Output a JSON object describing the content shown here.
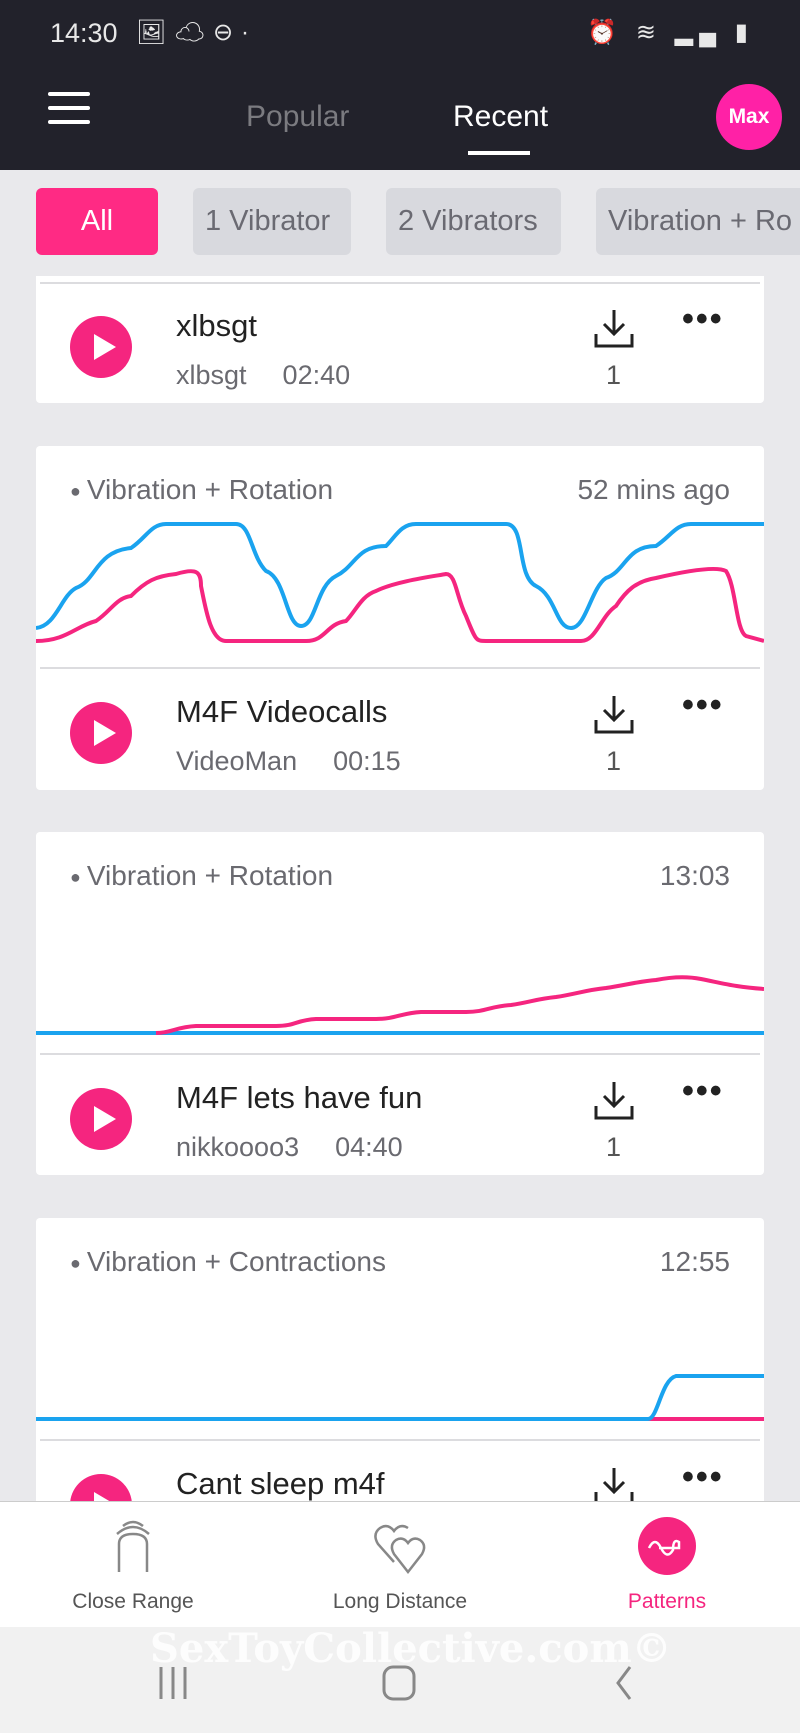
{
  "status_bar": {
    "time": "14:30",
    "left_icons": [
      "image-icon",
      "cloud-sync-icon",
      "dnd-icon",
      "dot-icon"
    ],
    "right_icons": [
      "alarm-icon",
      "wifi-icon",
      "signal-icon",
      "battery-icon"
    ]
  },
  "header": {
    "tabs": [
      {
        "label": "Popular",
        "active": false
      },
      {
        "label": "Recent",
        "active": true
      }
    ],
    "avatar": "Max"
  },
  "filters": [
    {
      "label": "All",
      "active": true
    },
    {
      "label": "1 Vibrator"
    },
    {
      "label": "2 Vibrators"
    },
    {
      "label": "Vibration + Ro"
    }
  ],
  "patterns": [
    {
      "title": "xlbsgt",
      "author": "xlbsgt",
      "duration": "02:40",
      "downloads": "1"
    },
    {
      "type": "Vibration + Rotation",
      "when": "52 mins ago",
      "title": "M4F Videocalls",
      "author": "VideoMan",
      "duration": "00:15",
      "downloads": "1"
    },
    {
      "type": "Vibration + Rotation",
      "when": "13:03",
      "title": "M4F lets have fun",
      "author": "nikkoooo3",
      "duration": "04:40",
      "downloads": "1"
    },
    {
      "type": "Vibration + Contractions",
      "when": "12:55",
      "title": "Cant sleep m4f"
    }
  ],
  "bottom_nav": [
    {
      "label": "Close Range"
    },
    {
      "label": "Long Distance"
    },
    {
      "label": "Patterns",
      "active": true
    }
  ],
  "watermark": "SexToyCollective.com©",
  "colors": {
    "accent": "#f5257f",
    "blue_line": "#1aa3ef",
    "header_bg": "#22222b"
  }
}
